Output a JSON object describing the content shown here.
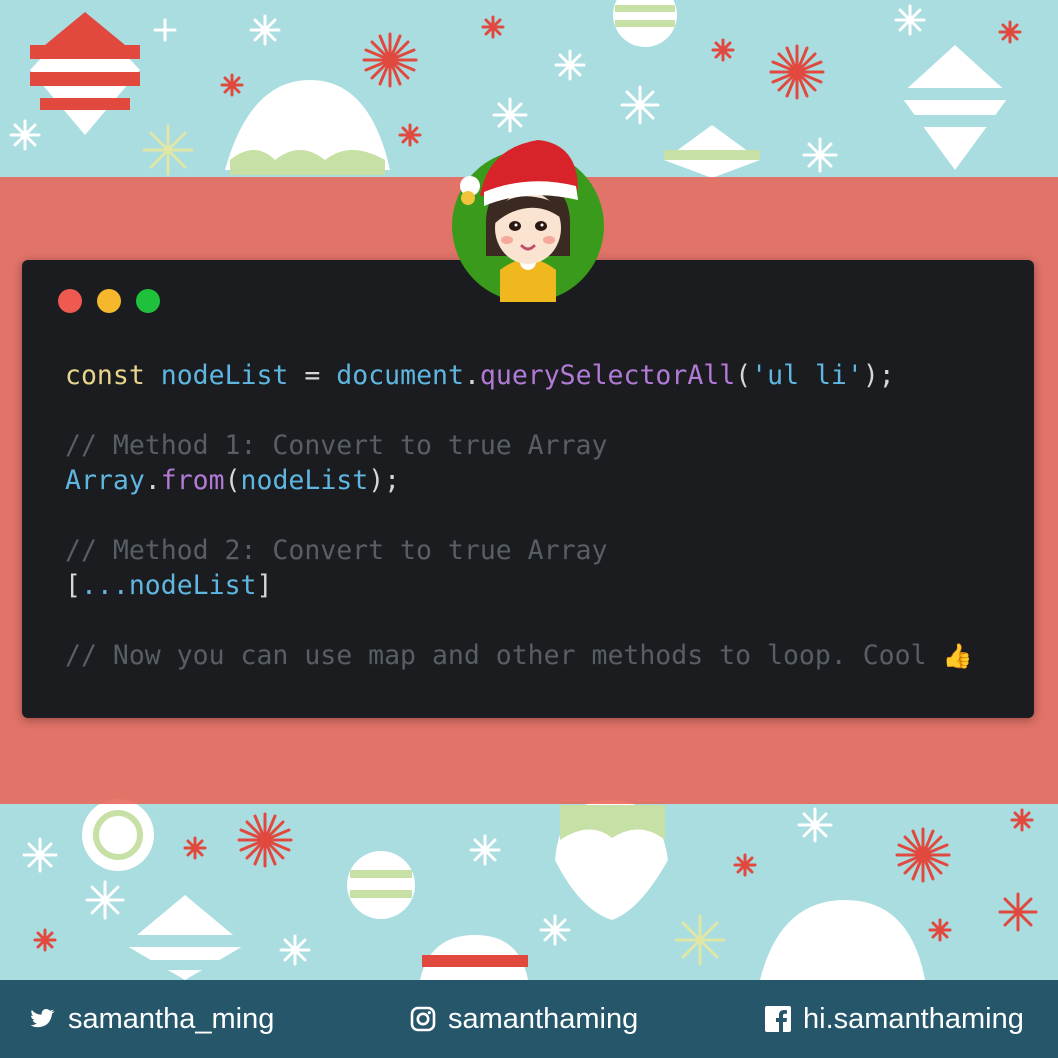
{
  "window_controls": {
    "close_color": "#ef5a50",
    "minimize_color": "#f5b82c",
    "maximize_color": "#1fc03c"
  },
  "code": {
    "line1": {
      "keyword": "const",
      "variable": "nodeList",
      "operator": "=",
      "object": "document",
      "method": "querySelectorAll",
      "argument": "'ul li'"
    },
    "comment1": "// Method 1: Convert to true Array",
    "line2": {
      "object": "Array",
      "method": "from",
      "argument": "nodeList"
    },
    "comment2": "// Method 2: Convert to true Array",
    "line3": {
      "spread": "...",
      "variable": "nodeList"
    },
    "comment3": "// Now you can use map and other methods to loop. Cool",
    "comment3_emoji": "👍"
  },
  "footer": {
    "twitter": "samantha_ming",
    "instagram": "samanthaming",
    "facebook": "hi.samanthaming"
  },
  "icons": {
    "twitter": "twitter-icon",
    "instagram": "instagram-icon",
    "facebook": "facebook-icon",
    "avatar": "avatar-santa-hat"
  },
  "colors": {
    "background": "#a9dde0",
    "band": "#e96458",
    "editor": "#1b1c1f",
    "footer": "#25566a"
  }
}
